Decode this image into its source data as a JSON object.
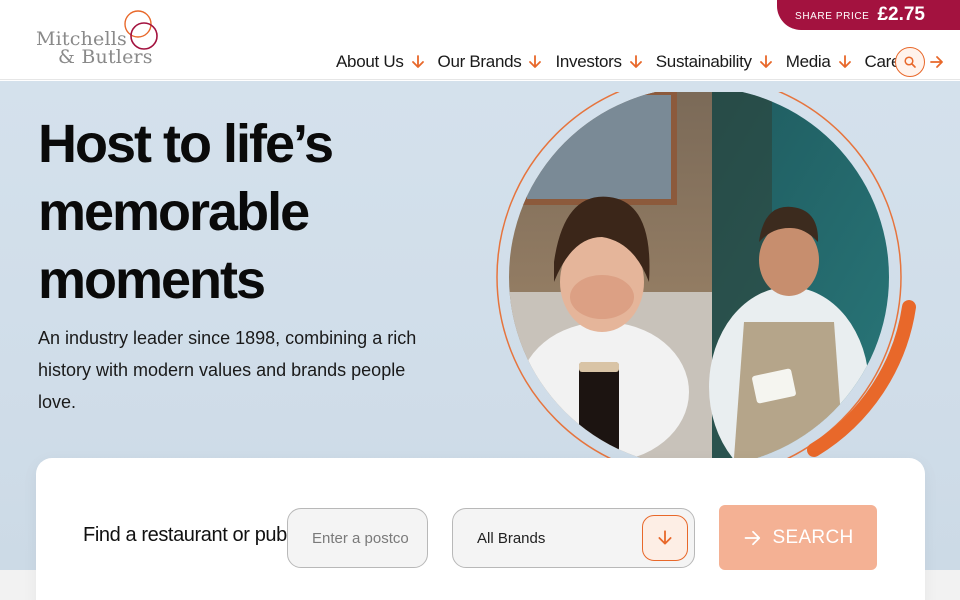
{
  "brand": {
    "logo_line1": "Mitchells",
    "logo_line2": "& Butlers"
  },
  "share_price": {
    "label": "SHARE PRICE",
    "value": "£2.75"
  },
  "nav": {
    "items": [
      {
        "label": "About Us",
        "icon": "chevron-down-icon"
      },
      {
        "label": "Our Brands",
        "icon": "chevron-down-icon"
      },
      {
        "label": "Investors",
        "icon": "chevron-down-icon"
      },
      {
        "label": "Sustainability",
        "icon": "chevron-down-icon"
      },
      {
        "label": "Media",
        "icon": "chevron-down-icon"
      },
      {
        "label": "Careers",
        "icon": "arrow-right-icon"
      }
    ],
    "search_icon": "search-icon"
  },
  "hero": {
    "title_lines": [
      "Host to life’s",
      "memorable",
      "moments"
    ],
    "subtitle": "An industry leader since 1898, combining a rich history with modern values and brands people love."
  },
  "finder": {
    "label": "Find a restaurant or pub",
    "postcode_placeholder": "Enter a postco",
    "brand_selected": "All Brands",
    "search_label": "SEARCH"
  },
  "colors": {
    "accent_orange": "#e8682a",
    "brand_red": "#a3123f",
    "hero_bg": "#d4e1ec",
    "search_btn_bg": "#f4b194"
  }
}
